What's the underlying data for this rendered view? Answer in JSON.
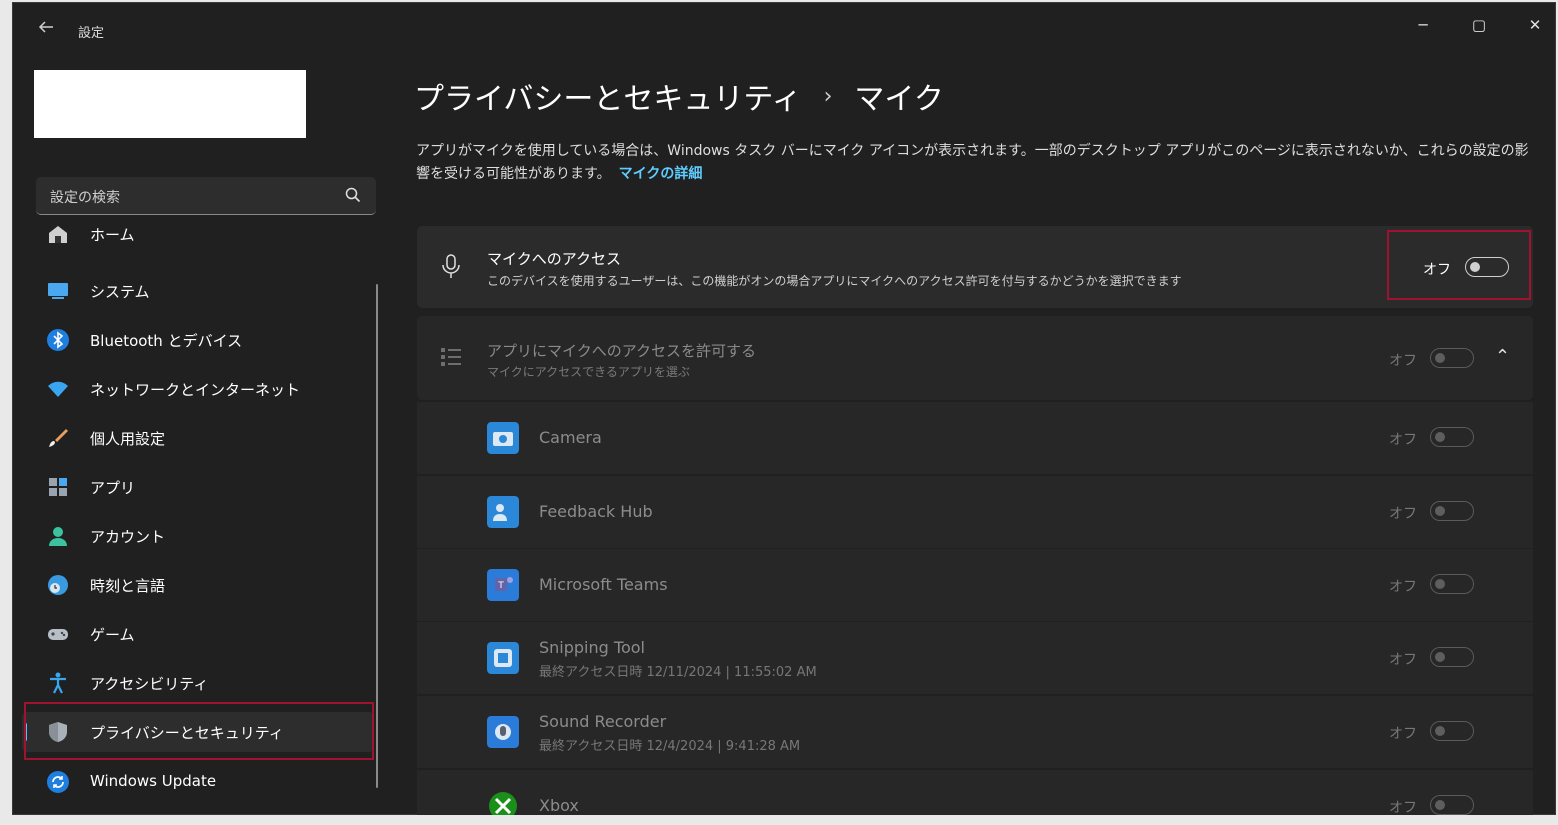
{
  "window": {
    "title": "設定",
    "controls": {
      "minimize": "─",
      "maximize": "▢",
      "close": "✕"
    }
  },
  "search": {
    "placeholder": "設定の検索"
  },
  "nav": [
    {
      "label": "ホーム",
      "icon": "home-icon"
    },
    {
      "label": "システム",
      "icon": "system-icon"
    },
    {
      "label": "Bluetooth とデバイス",
      "icon": "bluetooth-icon"
    },
    {
      "label": "ネットワークとインターネット",
      "icon": "wifi-icon"
    },
    {
      "label": "個人用設定",
      "icon": "brush-icon"
    },
    {
      "label": "アプリ",
      "icon": "apps-icon"
    },
    {
      "label": "アカウント",
      "icon": "account-icon"
    },
    {
      "label": "時刻と言語",
      "icon": "time-language-icon"
    },
    {
      "label": "ゲーム",
      "icon": "gamepad-icon"
    },
    {
      "label": "アクセシビリティ",
      "icon": "accessibility-icon"
    },
    {
      "label": "プライバシーとセキュリティ",
      "icon": "shield-icon",
      "active": true
    },
    {
      "label": "Windows Update",
      "icon": "update-icon"
    }
  ],
  "breadcrumb": {
    "parent": "プライバシーとセキュリティ",
    "separator": "›",
    "current": "マイク"
  },
  "description": {
    "text": "アプリがマイクを使用している場合は、Windows タスク バーにマイク アイコンが表示されます。一部のデスクトップ アプリがこのページに表示されないか、これらの設定の影響を受ける可能性があります。",
    "link": "マイクの詳細"
  },
  "mic_access": {
    "title": "マイクへのアクセス",
    "subtitle": "このデバイスを使用するユーザーは、この機能がオンの場合アプリにマイクへのアクセス許可を付与するかどうかを選択できます",
    "state": "オフ",
    "on": false
  },
  "app_access": {
    "title": "アプリにマイクへのアクセスを許可する",
    "subtitle": "マイクにアクセスできるアプリを選ぶ",
    "state": "オフ",
    "on": false,
    "expand_glyph": "⌃"
  },
  "apps": [
    {
      "name": "Camera",
      "meta": "",
      "state": "オフ",
      "on": false,
      "color": "#2b88d8",
      "icon": "camera-icon"
    },
    {
      "name": "Feedback Hub",
      "meta": "",
      "state": "オフ",
      "on": false,
      "color": "#2b88d8",
      "icon": "feedback-hub-icon"
    },
    {
      "name": "Microsoft Teams",
      "meta": "",
      "state": "オフ",
      "on": false,
      "color": "#2b7bd8",
      "icon": "teams-icon"
    },
    {
      "name": "Snipping Tool",
      "meta": "最終アクセス日時 12/11/2024 | 11:55:02 AM",
      "state": "オフ",
      "on": false,
      "color": "#2b88d8",
      "icon": "snipping-tool-icon"
    },
    {
      "name": "Sound Recorder",
      "meta": "最終アクセス日時 12/4/2024 | 9:41:28 AM",
      "state": "オフ",
      "on": false,
      "color": "#2b7bd8",
      "icon": "sound-recorder-icon"
    },
    {
      "name": "Xbox",
      "meta": "",
      "state": "オフ",
      "on": false,
      "color": "#1a8f1a",
      "icon": "xbox-icon"
    }
  ]
}
